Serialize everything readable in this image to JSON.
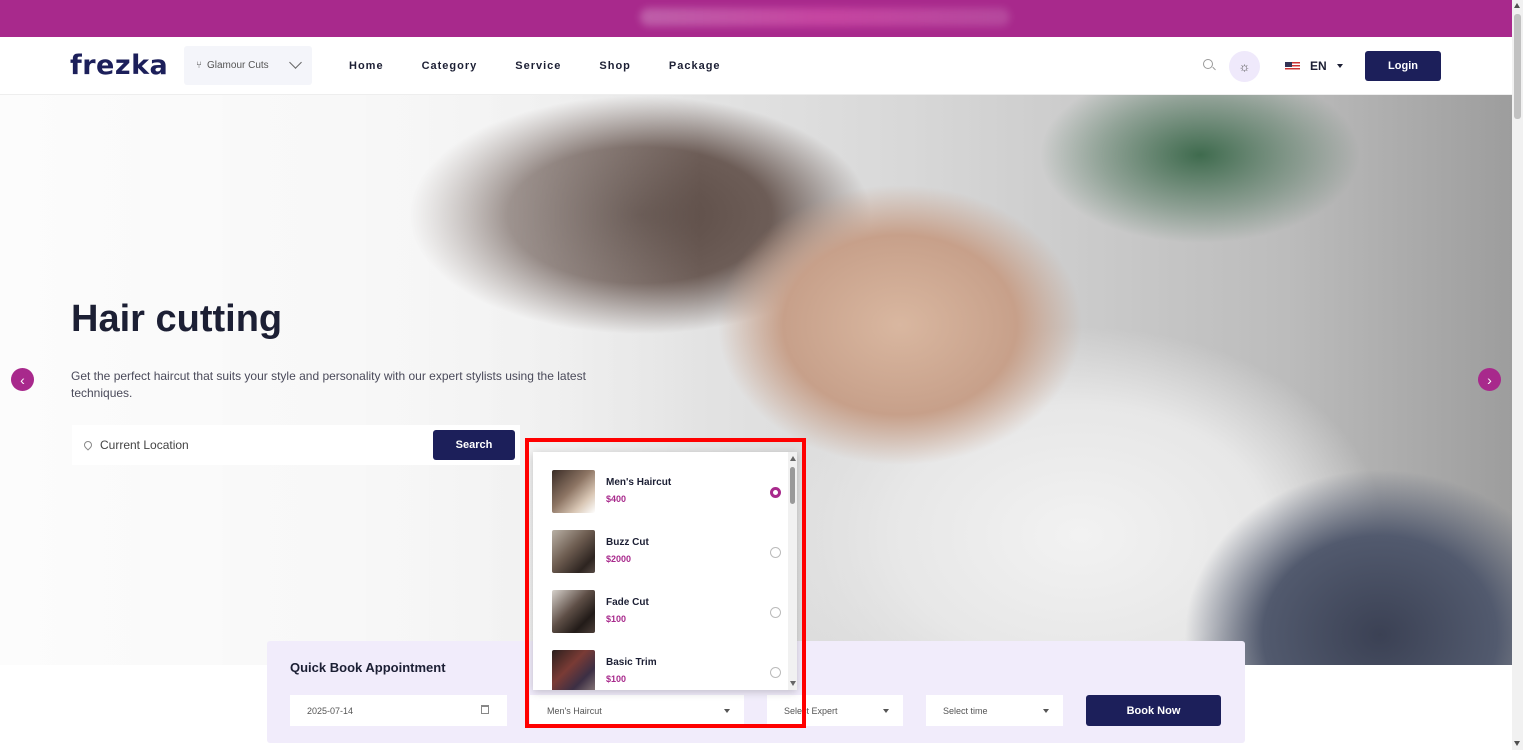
{
  "header": {
    "logo": "frezka",
    "branch": {
      "label": "Glamour Cuts",
      "icon": "branch-icon"
    },
    "nav": [
      "Home",
      "Category",
      "Service",
      "Shop",
      "Package"
    ],
    "language": "EN",
    "login_label": "Login"
  },
  "hero": {
    "title": "Hair cutting",
    "description": "Get the perfect haircut that suits your style and personality with our expert stylists using the latest techniques.",
    "location_placeholder": "Current Location",
    "search_label": "Search"
  },
  "quick_book": {
    "title": "Quick Book Appointment",
    "date": "2025-07-14",
    "service": "Men's Haircut",
    "expert_placeholder": "Select Expert",
    "time_placeholder": "Select time",
    "book_label": "Book Now"
  },
  "service_dropdown": {
    "items": [
      {
        "name": "Men's Haircut",
        "price": "$400",
        "selected": true
      },
      {
        "name": "Buzz Cut",
        "price": "$2000",
        "selected": false
      },
      {
        "name": "Fade Cut",
        "price": "$100",
        "selected": false
      },
      {
        "name": "Basic Trim",
        "price": "$100",
        "selected": false
      }
    ]
  },
  "colors": {
    "brand": "#a8298c",
    "primary": "#1c1f5a",
    "highlight": "#ff0000",
    "panel": "#f1ecfb"
  }
}
